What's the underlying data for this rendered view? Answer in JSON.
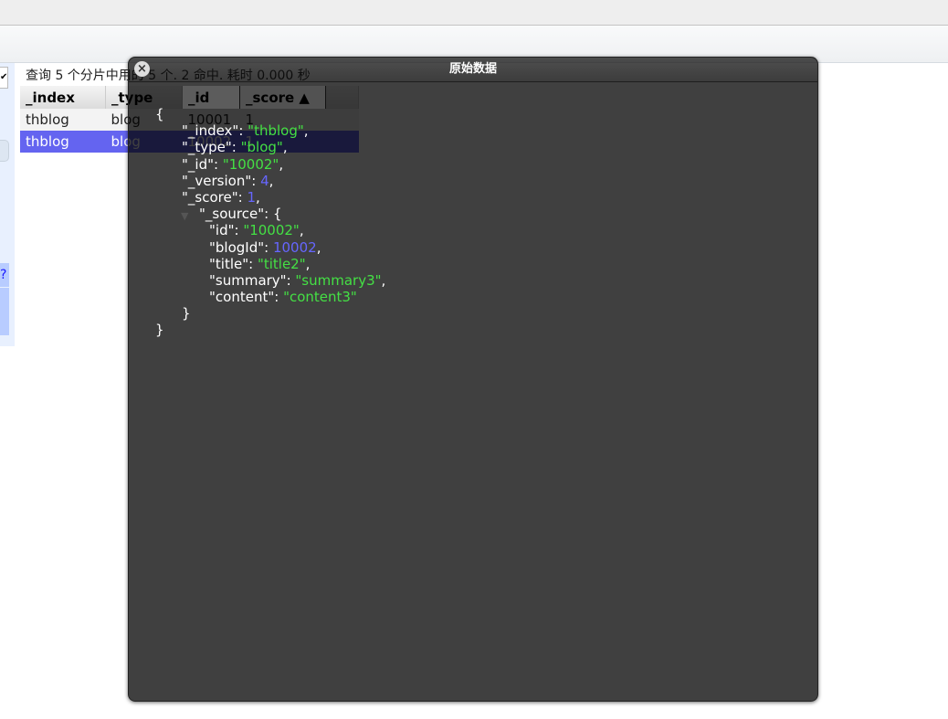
{
  "status": "查询 5 个分片中用的 5 个. 2 命中. 耗时 0.000 秒",
  "sidebar": {
    "select_arrow": "✔",
    "help": "?"
  },
  "table": {
    "columns": [
      "_index",
      "_type",
      "_id",
      "_score ▲",
      ""
    ],
    "rows": [
      [
        "thblog",
        "blog",
        "10001",
        "1"
      ],
      [
        "thblog",
        "blog",
        "10002",
        "1"
      ]
    ],
    "selected_row": 1,
    "selected_color": "#6464f0"
  },
  "modal": {
    "title": "原始数据",
    "close_icon": "×",
    "lines": [
      {
        "indent": 0,
        "text": "{"
      },
      {
        "indent": 1,
        "key": "_index",
        "value": "\"thblog\"",
        "vtype": "str",
        "comma": true
      },
      {
        "indent": 1,
        "key": "_type",
        "value": "\"blog\"",
        "vtype": "str",
        "comma": true
      },
      {
        "indent": 1,
        "key": "_id",
        "value": "\"10002\"",
        "vtype": "str",
        "comma": true
      },
      {
        "indent": 1,
        "key": "_version",
        "value": "4",
        "vtype": "num",
        "comma": true
      },
      {
        "indent": 1,
        "key": "_score",
        "value": "1",
        "vtype": "num",
        "comma": true
      },
      {
        "indent": 1,
        "key": "_source",
        "value": "{",
        "vtype": "plain",
        "collapsible": true
      },
      {
        "indent": 2,
        "key": "id",
        "value": "\"10002\"",
        "vtype": "str",
        "comma": true
      },
      {
        "indent": 2,
        "key": "blogId",
        "value": "10002",
        "vtype": "num",
        "comma": true
      },
      {
        "indent": 2,
        "key": "title",
        "value": "\"title2\"",
        "vtype": "str",
        "comma": true
      },
      {
        "indent": 2,
        "key": "summary",
        "value": "\"summary3\"",
        "vtype": "str",
        "comma": true
      },
      {
        "indent": 2,
        "key": "content",
        "value": "\"content3\"",
        "vtype": "str",
        "comma": false
      },
      {
        "indent": 1,
        "text": "}"
      },
      {
        "indent": 0,
        "text": "}"
      }
    ]
  }
}
